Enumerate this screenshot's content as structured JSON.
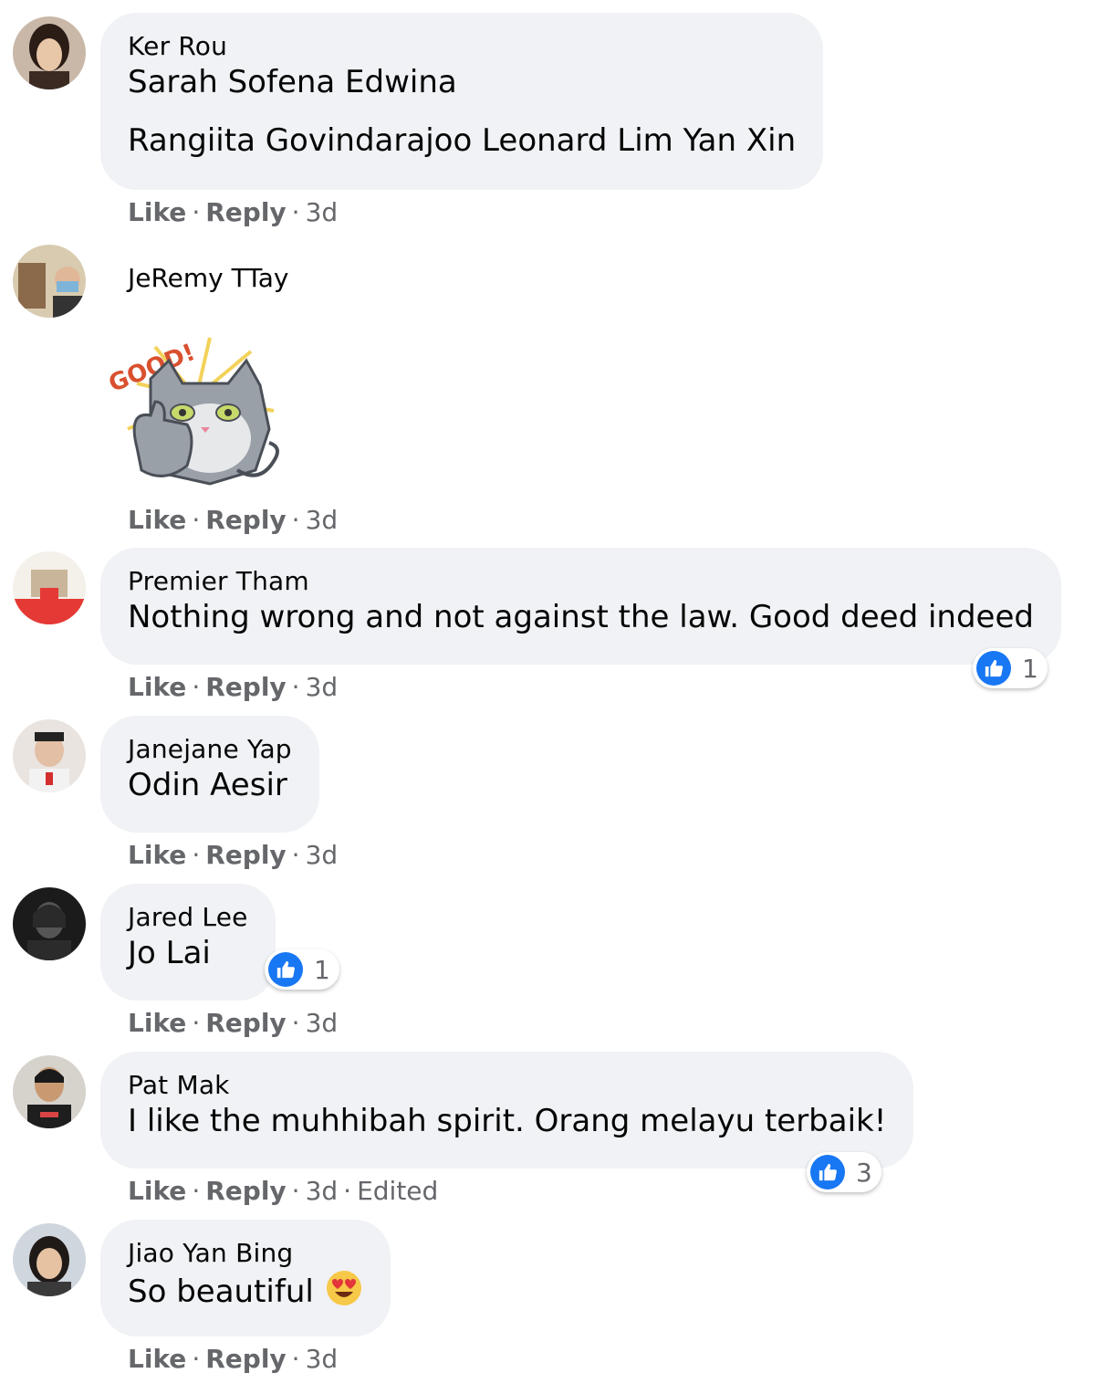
{
  "actions": {
    "like": "Like",
    "reply": "Reply",
    "dot": "·"
  },
  "comments": [
    {
      "name": "Ker Rou",
      "lines": [
        "Sarah Sofena Edwina",
        "Rangiita Govindarajoo Leonard Lim Yan Xin"
      ],
      "time": "3d"
    },
    {
      "name": "JeRemy TTay",
      "sticker": "GOOD!",
      "time": "3d"
    },
    {
      "name": "Premier Tham",
      "lines": [
        "Nothing wrong and not against the law. Good deed indeed"
      ],
      "time": "3d",
      "reactions": "1"
    },
    {
      "name": "Janejane Yap",
      "lines": [
        "Odin Aesir"
      ],
      "time": "3d"
    },
    {
      "name": "Jared Lee",
      "lines": [
        "Jo Lai"
      ],
      "time": "3d",
      "reactions": "1"
    },
    {
      "name": "Pat Mak",
      "lines": [
        "I like the muhhibah spirit. Orang melayu terbaik!"
      ],
      "time": "3d",
      "edited": "Edited",
      "reactions": "3"
    },
    {
      "name": "Jiao Yan Bing",
      "lines": [
        "So beautiful"
      ],
      "emoji": "heart-eyes-emoji",
      "time": "3d"
    }
  ],
  "colors": {
    "bubble": "#f0f2f5",
    "like_blue": "#1877f2",
    "meta_gray": "#65676b"
  }
}
